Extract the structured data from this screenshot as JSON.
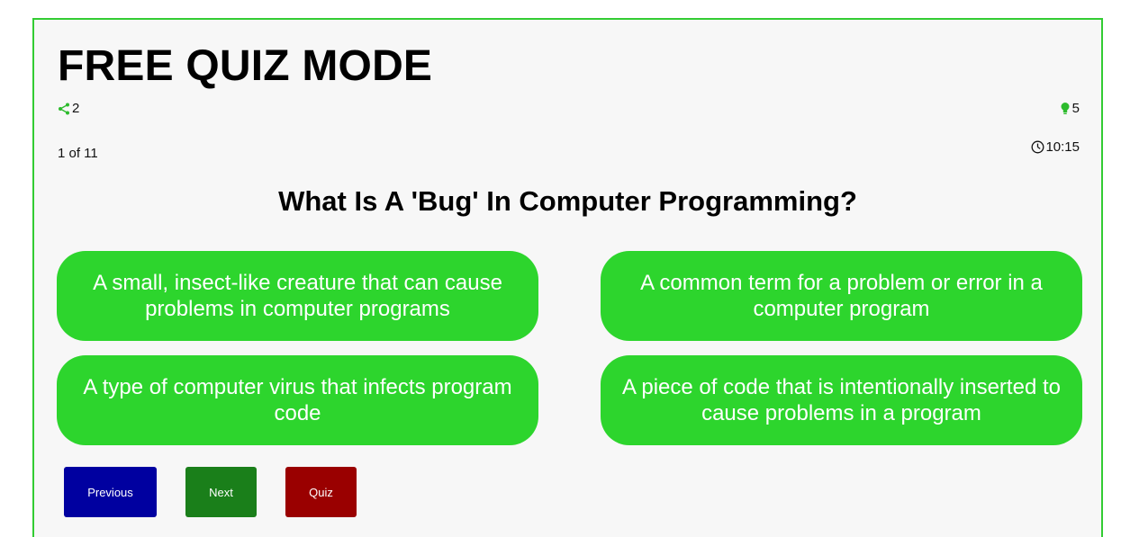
{
  "header": {
    "title": "FREE QUIZ MODE"
  },
  "stats": {
    "share_count": "2",
    "share_icon": "share-icon",
    "hint_count": "5",
    "hint_icon": "lightbulb-icon"
  },
  "progress": {
    "text": "1 of 11"
  },
  "timer": {
    "value": "10:15",
    "icon": "clock-icon"
  },
  "question": {
    "text": "What Is A 'Bug' In Computer Programming?"
  },
  "answers": [
    {
      "text": "A small, insect-like creature that can cause problems in computer programs"
    },
    {
      "text": "A common term for a problem or error in a computer program"
    },
    {
      "text": "A type of computer virus that infects program code"
    },
    {
      "text": "A piece of code that is intentionally inserted to cause problems in a program"
    }
  ],
  "nav": {
    "previous_label": "Previous",
    "next_label": "Next",
    "quiz_label": "Quiz"
  },
  "colors": {
    "accent_green": "#2dd52d",
    "border_green": "#33cc33",
    "previous_blue": "#0000a0",
    "next_green": "#1a7f1a",
    "quiz_red": "#9a0000"
  }
}
